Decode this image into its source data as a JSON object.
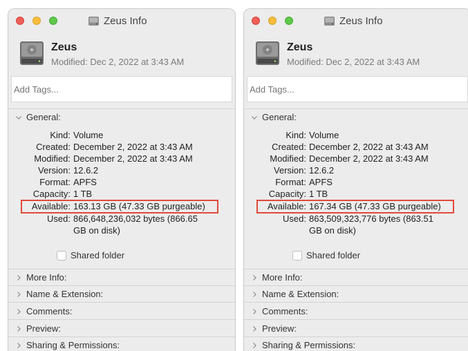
{
  "windows": [
    {
      "title": "Zeus Info",
      "name": "Zeus",
      "modified_header": "Modified: Dec 2, 2022 at 3:43 AM",
      "tags_placeholder": "Add Tags...",
      "general": {
        "label": "General:",
        "rows": [
          {
            "key": "Kind:",
            "value": "Volume"
          },
          {
            "key": "Created:",
            "value": "December 2, 2022 at 3:43 AM"
          },
          {
            "key": "Modified:",
            "value": "December 2, 2022 at 3:43 AM"
          },
          {
            "key": "Version:",
            "value": "12.6.2"
          },
          {
            "key": "Format:",
            "value": "APFS"
          },
          {
            "key": "Capacity:",
            "value": "1 TB"
          },
          {
            "key": "Available:",
            "value": "163.13 GB (47.33 GB purgeable)"
          },
          {
            "key": "Used:",
            "value": "866,648,236,032 bytes (866.65",
            "value2": "GB on disk)"
          }
        ]
      },
      "shared_folder_label": "Shared folder",
      "sections": [
        "More Info:",
        "Name & Extension:",
        "Comments:",
        "Preview:",
        "Sharing & Permissions:"
      ]
    },
    {
      "title": "Zeus Info",
      "name": "Zeus",
      "modified_header": "Modified: Dec 2, 2022 at 3:43 AM",
      "tags_placeholder": "Add Tags...",
      "general": {
        "label": "General:",
        "rows": [
          {
            "key": "Kind:",
            "value": "Volume"
          },
          {
            "key": "Created:",
            "value": "December 2, 2022 at 3:43 AM"
          },
          {
            "key": "Modified:",
            "value": "December 2, 2022 at 3:43 AM"
          },
          {
            "key": "Version:",
            "value": "12.6.2"
          },
          {
            "key": "Format:",
            "value": "APFS"
          },
          {
            "key": "Capacity:",
            "value": "1 TB"
          },
          {
            "key": "Available:",
            "value": "167.34 GB (47.33 GB purgeable)"
          },
          {
            "key": "Used:",
            "value": "863,509,323,776 bytes (863.51",
            "value2": "GB on disk)"
          }
        ]
      },
      "shared_folder_label": "Shared folder",
      "sections": [
        "More Info:",
        "Name & Extension:",
        "Comments:",
        "Preview:",
        "Sharing & Permissions:"
      ]
    }
  ],
  "colors": {
    "highlight": "#e24a3b",
    "close": "#ee5f57",
    "minimize": "#f6bd3b",
    "zoom": "#5ec84a"
  },
  "icons": [
    "disk-icon",
    "chevron-down-icon",
    "chevron-right-icon"
  ]
}
